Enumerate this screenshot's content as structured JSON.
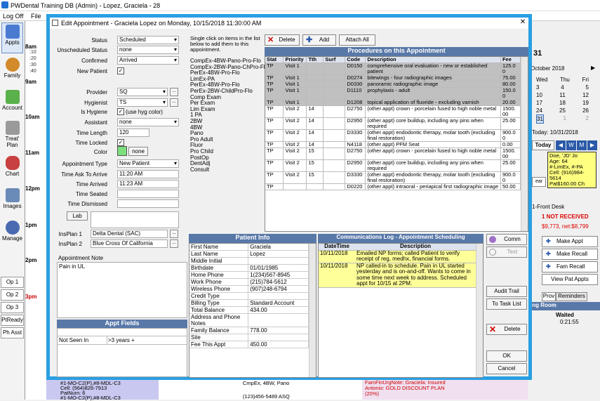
{
  "app": {
    "title": "PWDental Training DB (Admin) - Lopez, Graciela - 28"
  },
  "menu": {
    "logoff": "Log Off",
    "file": "File"
  },
  "modules": [
    {
      "label": "Appts"
    },
    {
      "label": "Family"
    },
    {
      "label": "Account"
    },
    {
      "label": "Treat' Plan"
    },
    {
      "label": "Chart"
    },
    {
      "label": "Images"
    },
    {
      "label": "Manage"
    }
  ],
  "ops": [
    "Op 1",
    "Op 2",
    "Op 3",
    "PtReady",
    "Ph Asst"
  ],
  "schedule": {
    "hours": [
      "8am",
      "9am",
      "10am",
      "11am",
      "12pm",
      "1pm",
      "2pm",
      "3pm"
    ],
    "minutes": [
      ":10",
      ":20",
      ":30",
      ":40",
      ":50"
    ],
    "peek_left": [
      "#1-MO-C2(P),#8-MDL-C3",
      "Cell: (564)826-7913",
      "PatNum: 6",
      "#1-MO-C2(P),#8-MDL-C3"
    ],
    "peek_mid1": "CmpEx, 4BW, Pano",
    "peek_mid2": "(123)456-5489  ASQ",
    "peek_right1": "FamFinUrgNote: Graciela: Insured",
    "peek_right2": "Antonio: GOLD DISCOUNT PLAN",
    "peek_right3": "(20%)"
  },
  "right_panel": {
    "month": "October 2018",
    "day_heads": [
      "Wed",
      "Thu",
      "Fri"
    ],
    "days": [
      [
        "3",
        "4",
        "5"
      ],
      [
        "10",
        "11",
        "12"
      ],
      [
        "17",
        "18",
        "19"
      ],
      [
        "24",
        "25",
        "26"
      ],
      [
        "31",
        "1",
        "2"
      ]
    ],
    "big_day": "31",
    "today": "Today: 10/31/2018",
    "today_btn": "Today",
    "nav": [
      "W",
      "M"
    ],
    "pat_card": [
      "Doe, 'JD' Jo",
      "Age: 64",
      "#-LimEx, #-PA",
      "Cell: (916)984-",
      "5614",
      "Pat$160.00 Ch"
    ],
    "front_desk": "1-Front Desk",
    "not_received": "1 NOT RECEIVED",
    "balances": "$9,773, net:$8,799",
    "make_appt": "Make Appt",
    "make_recall": "Make Recall",
    "fam_recall": "Fam Recall",
    "view_pat_appts": "View Pat Appts",
    "tabs": [
      "Prov",
      "Reminders"
    ],
    "waiting_room": "ing Room",
    "waited_hdr": "Waited",
    "waited_val": "0:21:55",
    "clear_btn": "ear"
  },
  "dialog": {
    "title": "Edit Appointment - Graciela Lopez on Monday, 10/15/2018 11:30:00 AM",
    "close": "✕",
    "fields": {
      "status_label": "Status",
      "status": "Scheduled",
      "unsched_label": "Unscheduled Status",
      "unsched": "none",
      "confirmed_label": "Confirmed",
      "confirmed": "Arrived",
      "newpat_label": "New Patient",
      "provider_label": "Provider",
      "provider": "SQ",
      "hygienist_label": "Hygienist",
      "hygienist": "TS",
      "ishyg_label": "Is Hygiene",
      "use_hyg": "(use hyg color)",
      "assistant_label": "Assistant",
      "assistant": "none",
      "timelen_label": "Time Length",
      "timelen": "120",
      "timelocked_label": "Time Locked",
      "color_label": "Color",
      "color_btn": "none",
      "appttype_label": "Appointment Type",
      "appttype": "New Patient",
      "timeask_label": "Time Ask To Arrive",
      "timeask": "11:20 AM",
      "timearrived_label": "Time Arrived",
      "timearrived": "11:23 AM",
      "timeseated_label": "Time Seated",
      "timeseated": "",
      "timedismissed_label": "Time Dismissed",
      "timedismissed": "",
      "lab_btn": "Lab",
      "insplan1_label": "InsPlan 1",
      "insplan1": "Delta Dental (SAC)",
      "insplan2_label": "InsPlan 2",
      "insplan2": "Blue Cross Of California",
      "more": "..."
    },
    "appt_note_label": "Appointment Note",
    "appt_note": "Pain in UL",
    "appt_fields": {
      "header": "Appt Fields",
      "rows": [
        {
          "name": "Not Seen In",
          "value": ">3 years +"
        }
      ]
    },
    "quickadd": {
      "instructions": "Single click on items in the list below to add them to this appointment.",
      "items": [
        "CompEx-4BW-Pano-Pro-Flo",
        "CompEx-2BW-Pano-ChPro-Flo",
        "PerEx-4BW-Pro-Flo",
        "LimEx-PA",
        "PerEx-4BW-Pro-Flo",
        "PerEx-2BW-ChildPro-Flo",
        "Comp Exam",
        "Per Exam",
        "Lim Exam",
        "1 PA",
        "2BW",
        "4BW",
        "Pano",
        "Pro Adult",
        "Fluor",
        "Pro Child",
        "PostOp",
        "DentAdj",
        "Consult"
      ]
    },
    "proc_buttons": {
      "delete": "Delete",
      "add": "Add",
      "attach_all": "Attach All"
    },
    "procedures": {
      "header": "Procedures on this Appointment",
      "columns": [
        "Stat",
        "Priority",
        "Tth",
        "Surf",
        "Code",
        "Description",
        "Fee"
      ],
      "rows": [
        {
          "stat": "TP",
          "priority": "Visit 1",
          "tth": "",
          "surf": "",
          "code": "D0150",
          "desc": "comprehensive oral evaluation - new or established patient",
          "fee": "125.0 0",
          "grey": true
        },
        {
          "stat": "TP",
          "priority": "Visit 1",
          "tth": "",
          "surf": "",
          "code": "D0274",
          "desc": "bitewings - four radiographic images",
          "fee": "75.00",
          "grey": true
        },
        {
          "stat": "TP",
          "priority": "Visit 1",
          "tth": "",
          "surf": "",
          "code": "D0330",
          "desc": "panoramic radiographic image",
          "fee": "80.00",
          "grey": true
        },
        {
          "stat": "TP",
          "priority": "Visit 1",
          "tth": "",
          "surf": "",
          "code": "D1110",
          "desc": "prophylaxis - adult",
          "fee": "150.0 0",
          "grey": true
        },
        {
          "stat": "TP",
          "priority": "Visit 1",
          "tth": "",
          "surf": "",
          "code": "D1208",
          "desc": "topical application of fluoride - excluding varnish",
          "fee": "20.00",
          "grey": true
        },
        {
          "stat": "TP",
          "priority": "Visit 2",
          "tth": "14",
          "surf": "",
          "code": "D2750",
          "desc": "(other appt) crown - porcelain fused to high noble metal",
          "fee": "1500. 00",
          "grey": false
        },
        {
          "stat": "TP",
          "priority": "Visit 2",
          "tth": "14",
          "surf": "",
          "code": "D2950",
          "desc": "(other appt) core buildup, including any pins when required",
          "fee": "25.00",
          "grey": false
        },
        {
          "stat": "TP",
          "priority": "Visit 2",
          "tth": "14",
          "surf": "",
          "code": "D3330",
          "desc": "(other appt) endodontic therapy, molar tooth (excluding final restoration)",
          "fee": "900.0 0",
          "grey": false
        },
        {
          "stat": "TP",
          "priority": "Visit 2",
          "tth": "14",
          "surf": "",
          "code": "N4118",
          "desc": "(other appt) PFM Seat",
          "fee": "0.00",
          "grey": false
        },
        {
          "stat": "TP",
          "priority": "Visit 2",
          "tth": "15",
          "surf": "",
          "code": "D2750",
          "desc": "(other appt) crown - porcelain fused to high noble metal",
          "fee": "1500. 00",
          "grey": false
        },
        {
          "stat": "TP",
          "priority": "Visit 2",
          "tth": "15",
          "surf": "",
          "code": "D2950",
          "desc": "(other appt) core buildup, including any pins when required",
          "fee": "25.00",
          "grey": false
        },
        {
          "stat": "TP",
          "priority": "Visit 2",
          "tth": "15",
          "surf": "",
          "code": "D3330",
          "desc": "(other appt) endodontic therapy, molar tooth (excluding final restoration)",
          "fee": "900.0 0",
          "grey": false
        },
        {
          "stat": "TP",
          "priority": "",
          "tth": "",
          "surf": "",
          "code": "D0220",
          "desc": "(other appt) intraoral - periapical first radiographic image",
          "fee": "50.00",
          "grey": false
        }
      ]
    },
    "patient_info": {
      "header": "Patient Info",
      "rows": [
        {
          "k": "First Name",
          "v": "Graciela"
        },
        {
          "k": "Last Name",
          "v": "Lopez"
        },
        {
          "k": "Middle Initial",
          "v": ""
        },
        {
          "k": "Birthdate",
          "v": "01/01/1985"
        },
        {
          "k": "Home Phone",
          "v": "1(234)567-8945"
        },
        {
          "k": "Work Phone",
          "v": "(215)784-5612"
        },
        {
          "k": "Wireless Phone",
          "v": "(907)248-6794"
        },
        {
          "k": "Credit Type",
          "v": ""
        },
        {
          "k": "Billing Type",
          "v": "Standard Account"
        },
        {
          "k": "Total Balance",
          "v": "434.00"
        },
        {
          "k": "Address and Phone Notes",
          "v": ""
        },
        {
          "k": "Family Balance",
          "v": "778.00"
        },
        {
          "k": "Site",
          "v": ""
        },
        {
          "k": "Fee This Appt",
          "v": "450.00"
        }
      ]
    },
    "comm_log": {
      "header": "Communications Log - Appointment Scheduling",
      "columns": [
        "DateTime",
        "Description"
      ],
      "rows": [
        {
          "date": "10/11/2018",
          "desc": "Emailed NP forms; called Patient to verify receipt of reg, medhx, financial forms."
        },
        {
          "date": "10/11/2018",
          "desc": "NP called-in to schedule. Pain in UL started yesterday and is on-and-off.  Wants to come in some time next week to address. Scheduled appt for 10/15 at 2PM."
        }
      ]
    },
    "side_buttons": {
      "comm": "Comm",
      "text": "Text",
      "audit": "Audit Trail",
      "task": "To Task List",
      "delete": "Delete",
      "ok": "OK",
      "cancel": "Cancel"
    }
  }
}
